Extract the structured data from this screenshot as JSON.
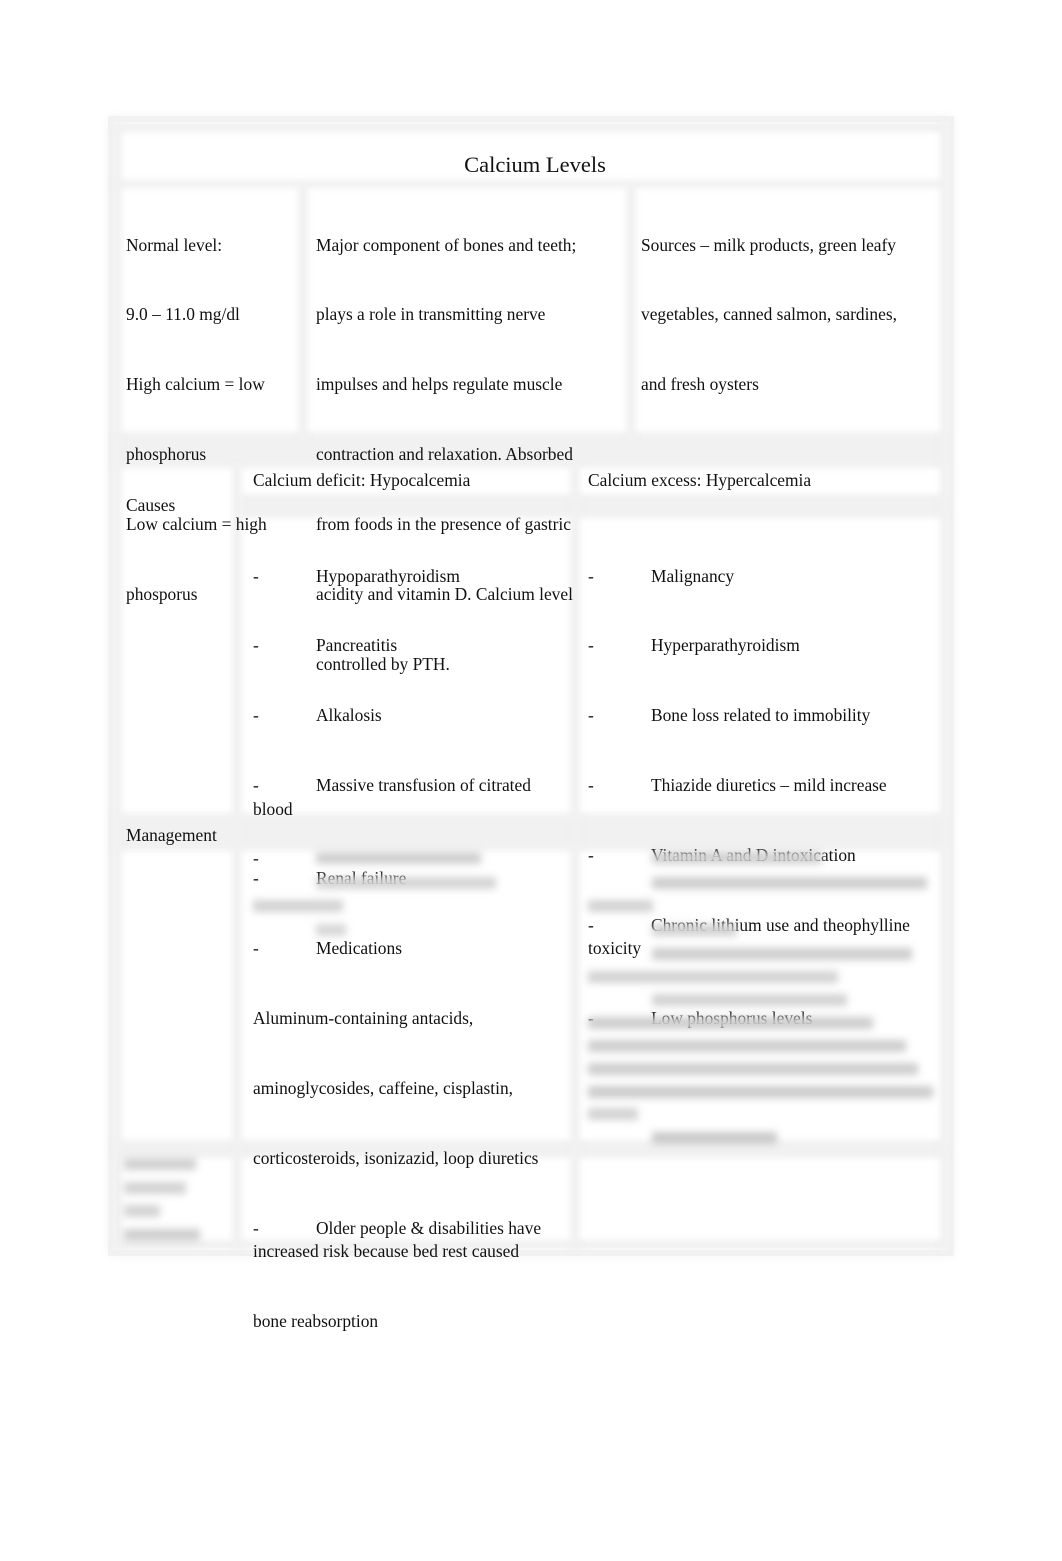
{
  "document": {
    "title": "Calcium Levels",
    "overview": {
      "normal_level": [
        "Normal level:",
        "9.0 – 11.0 mg/dl",
        "High calcium = low",
        "phosphorus",
        "Low calcium = high",
        "phosporus"
      ],
      "description": [
        "Major component of bones and teeth;",
        "plays a role in transmitting nerve",
        "impulses and helps regulate muscle",
        "contraction and relaxation. Absorbed",
        "from foods in the presence of gastric",
        "acidity and vitamin D. Calcium level",
        "controlled by PTH."
      ],
      "sources": [
        "Sources – milk products, green leafy",
        "vegetables, canned salmon, sardines,",
        "and fresh oysters"
      ]
    },
    "columns": {
      "deficit": "Calcium deficit: Hypocalcemia",
      "excess": "Calcium excess: Hypercalcemia"
    },
    "rows": {
      "causes_label": "Causes",
      "management_label": "Management",
      "last_label_blurred": "(blurred)"
    },
    "causes_deficit": [
      {
        "dash": "-",
        "text": "Hypoparathyroidism"
      },
      {
        "dash": "-",
        "text": "Pancreatitis"
      },
      {
        "dash": "-",
        "text": "Alkalosis"
      },
      {
        "dash": "-",
        "text": "Massive transfusion of citrated",
        "cont": "blood"
      },
      {
        "dash": "-",
        "text": "Renal failure"
      },
      {
        "dash": "-",
        "text": "Medications"
      },
      {
        "dash": "",
        "text": "Aluminum-containing antacids,"
      },
      {
        "dash": "",
        "text": "aminoglycosides, caffeine, cisplastin,"
      },
      {
        "dash": "",
        "text": "corticosteroids, isonizazid, loop diuretics"
      },
      {
        "dash": "-",
        "text": "Older people & disabilities have",
        "cont": "increased risk because bed rest caused"
      },
      {
        "dash": "",
        "text": "bone reabsorption"
      }
    ],
    "causes_excess": [
      {
        "dash": "-",
        "text": "Malignancy"
      },
      {
        "dash": "-",
        "text": "Hyperparathyroidism"
      },
      {
        "dash": "-",
        "text": "Bone loss related to immobility"
      },
      {
        "dash": "-",
        "text": "Thiazide diuretics – mild increase"
      },
      {
        "dash": "-",
        "text": "Vitamin A and D intoxication"
      },
      {
        "dash": "-",
        "text": "Chronic lithium use and theophylline",
        "cont": "toxicity"
      },
      {
        "dash": "-",
        "text": "Low phosphorus levels"
      }
    ],
    "management_deficit_dash": "-"
  }
}
